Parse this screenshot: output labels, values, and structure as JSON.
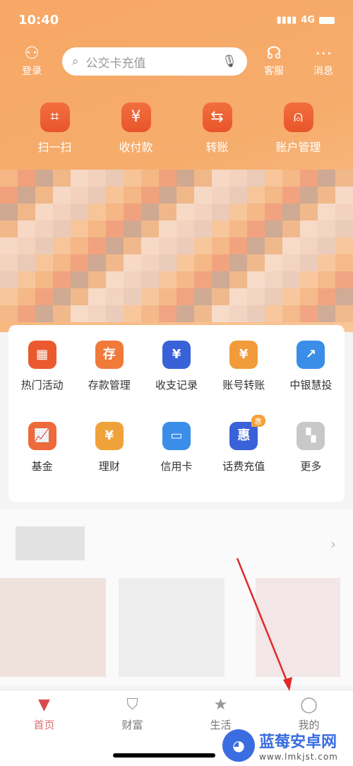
{
  "status": {
    "time": "10:40",
    "network": "4G"
  },
  "header": {
    "login": "登录",
    "search_placeholder": "公交卡充值",
    "service": "客服",
    "messages": "消息"
  },
  "quick_actions": [
    {
      "label": "扫一扫",
      "icon": "scan-icon",
      "glyph": "⌗"
    },
    {
      "label": "收付款",
      "icon": "yuan-icon",
      "glyph": "¥"
    },
    {
      "label": "转账",
      "icon": "transfer-icon",
      "glyph": "⇆"
    },
    {
      "label": "账户管理",
      "icon": "account-icon",
      "glyph": "⍝"
    }
  ],
  "grid": [
    {
      "label": "热门活动",
      "icon": "gift-icon",
      "glyph": "▦",
      "color": "#ea5a2e"
    },
    {
      "label": "存款管理",
      "icon": "piggy-bank-icon",
      "glyph": "存",
      "color": "#f07a3a"
    },
    {
      "label": "收支记录",
      "icon": "ledger-icon",
      "glyph": "¥",
      "color": "#3a62d8"
    },
    {
      "label": "账号转账",
      "icon": "account-transfer-icon",
      "glyph": "¥",
      "color": "#f29b3a"
    },
    {
      "label": "中银慧投",
      "icon": "robot-invest-icon",
      "glyph": "↗",
      "color": "#3a8ee8"
    },
    {
      "label": "基金",
      "icon": "fund-chart-icon",
      "glyph": "📈",
      "color": "#ee6a3a"
    },
    {
      "label": "理财",
      "icon": "money-bag-icon",
      "glyph": "¥",
      "color": "#f0a23a"
    },
    {
      "label": "信用卡",
      "icon": "credit-card-icon",
      "glyph": "▭",
      "color": "#3a8ee8"
    },
    {
      "label": "话费充值",
      "icon": "phone-recharge-icon",
      "glyph": "惠",
      "color": "#3a62d8",
      "badge": "惠"
    },
    {
      "label": "更多",
      "icon": "more-grid-icon",
      "glyph": "▚",
      "color": "#c8c8c8"
    }
  ],
  "tabs": [
    {
      "label": "首页",
      "icon": "home-icon",
      "glyph": "▼",
      "active": true
    },
    {
      "label": "财富",
      "icon": "wealth-icon",
      "glyph": "⛉"
    },
    {
      "label": "生活",
      "icon": "shopping-bag-icon",
      "glyph": "★"
    },
    {
      "label": "我的",
      "icon": "profile-icon",
      "glyph": "◯"
    }
  ],
  "watermark": {
    "name": "蓝莓安卓网",
    "url": "www.lmkjst.com"
  },
  "colors": {
    "brand_orange": "#f6a565",
    "accent_red": "#d94a4a",
    "annotation_arrow": "#e02a2a"
  }
}
